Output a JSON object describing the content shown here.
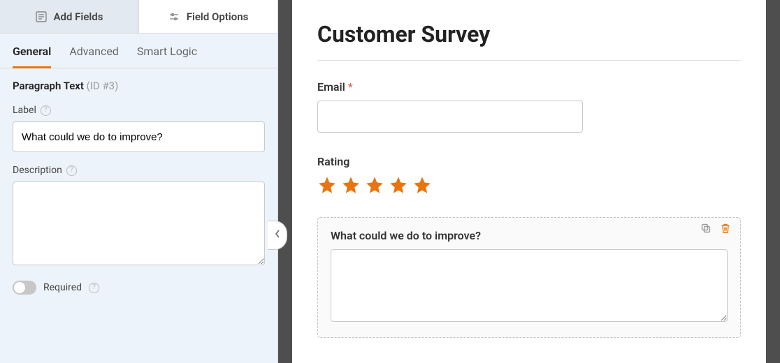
{
  "sidebar": {
    "topTabs": {
      "addFields": "Add Fields",
      "fieldOptions": "Field Options"
    },
    "subTabs": {
      "general": "General",
      "advanced": "Advanced",
      "smartLogic": "Smart Logic"
    },
    "fieldType": "Paragraph Text",
    "fieldId": "(ID #3)",
    "labels": {
      "label": "Label",
      "description": "Description",
      "required": "Required"
    },
    "values": {
      "label": "What could we do to improve?",
      "description": ""
    }
  },
  "preview": {
    "title": "Customer Survey",
    "email": {
      "label": "Email",
      "required": "*",
      "value": ""
    },
    "rating": {
      "label": "Rating",
      "value": 5,
      "max": 5
    },
    "paragraph": {
      "label": "What could we do to improve?",
      "value": ""
    }
  }
}
